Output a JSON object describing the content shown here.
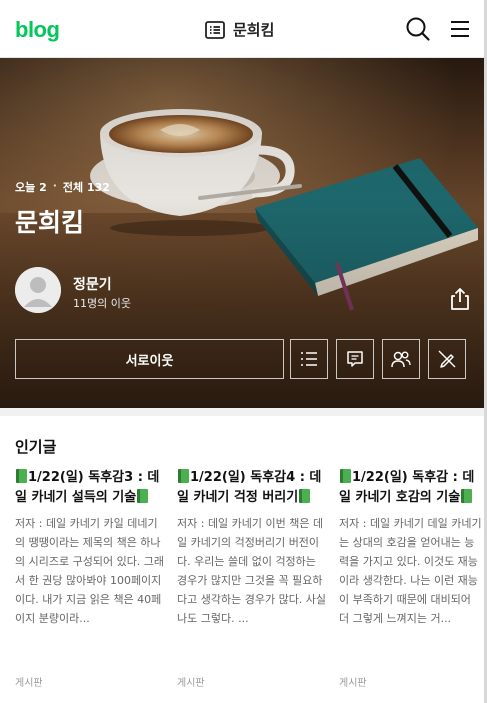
{
  "topbar": {
    "logo": "blog",
    "blog_name": "문희킴"
  },
  "hero": {
    "today_label": "오늘 2",
    "separator": "·",
    "total_label": "전체 132",
    "title": "문희킴",
    "owner_name": "정문기",
    "neighbors": "11명의 이웃",
    "neighbor_button": "서로이웃"
  },
  "popular": {
    "heading": "인기글",
    "posts": [
      {
        "title": "1/22(일) 독후감3 : 데일 카네기 설득의 기술",
        "body": "저자 : 데일 카네기 카일 데네기의 땡땡이라는 제목의 책은 하나의 시리즈로 구성되어 있다. 그래서 한 권당 많아봐야 100페이지이다. 내가 지금 읽은 책은 40페이지 분량이라...",
        "category": "게시판"
      },
      {
        "title": "1/22(일) 독후감4 : 데일 카네기 걱정 버리기",
        "body": "저자 : 데일 카네기 이번 책은 데일 카네기의 걱정버리기 버전이다. 우리는 쓸데 없이 걱정하는 경우가 많지만 그것을 꼭 필요하다고 생각하는 경우가 많다. 사실 나도 그렇다. ...",
        "category": "게시판"
      },
      {
        "title": "1/22(일) 독후감 : 데일 카네기 호감의 기술",
        "body": "저자 : 데일 카네기 데일 카네기는 상대의 호감을 얻어내는 능력을 가지고 있다. 이것도 재능이라 생각한다. 나는 이런 재능이 부족하기 때문에 대비되어 더 그렇게 느껴지는 거...",
        "category": "게시판"
      }
    ]
  },
  "icons": {
    "logo_color": "#03c75a",
    "book_emoji_color": "#4caf50"
  }
}
